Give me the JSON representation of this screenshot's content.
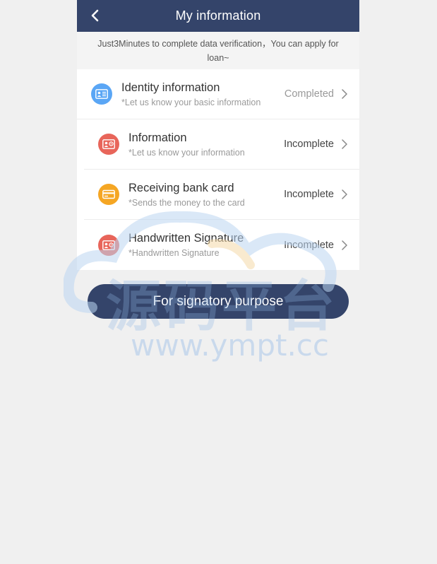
{
  "header": {
    "title": "My information"
  },
  "notice": {
    "text": "Just3Minutes to complete data verification，You can apply for loan~"
  },
  "items": [
    {
      "title": "Identity information",
      "subtitle": "*Let us know your basic information",
      "status": "Completed",
      "icon": "id-card-icon",
      "color": "#5aa6f5"
    },
    {
      "title": "Information",
      "subtitle": "*Let us know your information",
      "status": "Incomplete",
      "icon": "contact-card-icon",
      "color": "#e8655a"
    },
    {
      "title": "Receiving bank card",
      "subtitle": "*Sends the money to the card",
      "status": "Incomplete",
      "icon": "bank-card-icon",
      "color": "#f5a623"
    },
    {
      "title": "Handwritten Signature",
      "subtitle": "*Handwritten Signature",
      "status": "Incomplete",
      "icon": "signature-card-icon",
      "color": "#e8655a"
    }
  ],
  "button": {
    "label": "For signatory purpose"
  },
  "watermark": {
    "logo_text": "源码平台",
    "url_text": "www.ympt.cc"
  },
  "colors": {
    "primary": "#34446a",
    "background": "#f0f0f0"
  }
}
